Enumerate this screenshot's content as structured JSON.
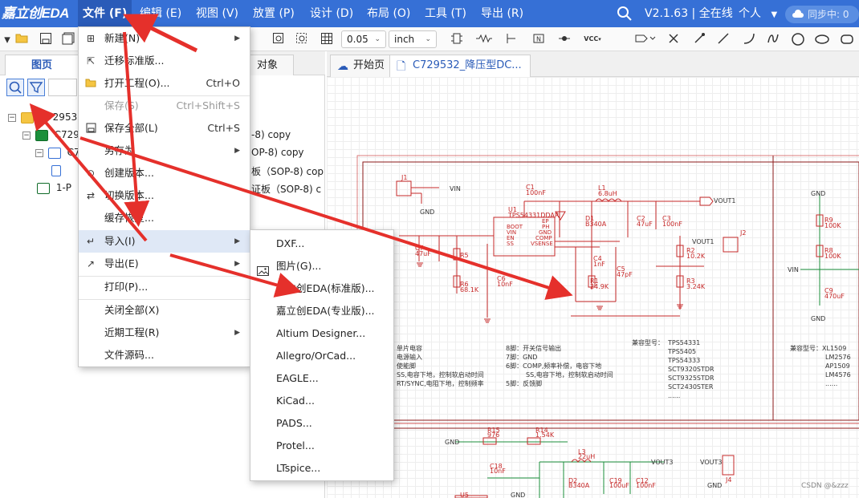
{
  "app": {
    "logo": "嘉立创EDA",
    "version_status": "V2.1.63 | 全在线",
    "user": "个人",
    "sync": "同步中: 0"
  },
  "menubar": [
    {
      "label": "文件 (F)",
      "active": true
    },
    {
      "label": "编辑 (E)"
    },
    {
      "label": "视图 (V)"
    },
    {
      "label": "放置 (P)"
    },
    {
      "label": "设计 (D)"
    },
    {
      "label": "布局 (O)"
    },
    {
      "label": "工具 (T)"
    },
    {
      "label": "导出 (R)"
    }
  ],
  "toolbar": {
    "grid_value": "0.05",
    "unit_value": "inch",
    "vcc_label": "VCC"
  },
  "left_panel": {
    "tabs": [
      "图页",
      "对象"
    ],
    "tree": [
      "C729532",
      "C7295",
      "C72",
      "1-P"
    ],
    "list_fragments": [
      "-8)   copy",
      "OP-8)   copy",
      "板（SOP-8)   cop",
      "证板（SOP-8)   c"
    ]
  },
  "editor_tabs": [
    {
      "label": "开始页"
    },
    {
      "label": "C729532_降压型DC..."
    }
  ],
  "file_menu": {
    "items": [
      {
        "label": "新建(N)",
        "icon": "new-file-icon",
        "submenu": true
      },
      {
        "label": "迁移标准版...",
        "icon": "migrate-icon"
      },
      {
        "label": "打开工程(O)...",
        "icon": "open-folder-icon",
        "shortcut": "Ctrl+O"
      },
      {
        "label": "保存(S)",
        "shortcut": "Ctrl+Shift+S",
        "disabled": true
      },
      {
        "label": "保存全部(L)",
        "icon": "save-icon",
        "shortcut": "Ctrl+S"
      },
      {
        "label": "另存为",
        "submenu": true
      },
      {
        "label": "创建版本...",
        "icon": "version-icon"
      },
      {
        "label": "切换版本...",
        "icon": "switch-version-icon"
      },
      {
        "label": "缓存恢复..."
      },
      {
        "label": "导入(I)",
        "icon": "import-icon",
        "submenu": true,
        "hover": true
      },
      {
        "label": "导出(E)",
        "icon": "export-icon",
        "submenu": true
      },
      {
        "label": "打印(P)..."
      },
      {
        "label": "关闭全部(X)"
      },
      {
        "label": "近期工程(R)",
        "submenu": true
      },
      {
        "label": "文件源码..."
      }
    ]
  },
  "import_submenu": {
    "items": [
      "DXF...",
      "图片(G)...",
      "嘉立创EDA(标准版)...",
      "嘉立创EDA(专业版)...",
      "Altium Designer...",
      "Allegro/OrCad...",
      "EAGLE...",
      "KiCad...",
      "PADS...",
      "Protel...",
      "LTspice..."
    ]
  },
  "schematic": {
    "refs": [
      "J1",
      "C1",
      "L1",
      "U1",
      "D1",
      "C2",
      "C3",
      "C4",
      "C5",
      "C6",
      "C7",
      "R1",
      "R2",
      "R3",
      "R5",
      "R6",
      "J2",
      "VIN",
      "GND",
      "VOUT1"
    ],
    "values": [
      "100nF",
      "6.8uH",
      "TPS54331DDAR",
      "B340A",
      "47uF",
      "100nF",
      "1nF",
      "47pF",
      "10nF",
      "24.9K",
      "10.2K",
      "3.24K",
      "68.1K"
    ],
    "u1_pins_left": [
      "BOOT",
      "VIN",
      "EN",
      "SS"
    ],
    "u1_pins_right": [
      "EP",
      "PH",
      "GND",
      "COMP",
      "VSENSE"
    ],
    "notes_left": [
      "单片电容",
      "电源输入",
      "使能脚",
      "SS,电容下地，控制软启动时间",
      "RT/SYNC,电阻下地，控制频率"
    ],
    "notes_pins": [
      "8脚：开关信号输出",
      "7脚：GND",
      "6脚：COMP,频率补偿，电容下地",
      "SS,电容下地，控制软启动时间",
      "5脚：反馈脚"
    ],
    "compat_title": "兼容型号：",
    "compat": [
      "TPS54331",
      "TPS5405",
      "TPS54333",
      "SCT9320STDR",
      "SCT9325STDR",
      "SCT2430STER",
      "......"
    ],
    "right_refs": [
      "R9",
      "100K",
      "R8",
      "100K",
      "C9",
      "470uF",
      "VIN",
      "GND"
    ],
    "compat2_title": "兼容型号：",
    "compat2": [
      "XL1509",
      "LM2576",
      "AP1509",
      "LM4576",
      "......"
    ],
    "bottom": [
      "R15",
      "976",
      "R14",
      "1.54K",
      "L3",
      "22uH",
      "C18",
      "10nF",
      "D2",
      "B340A",
      "C19",
      "100uF",
      "C12",
      "100nF",
      "VOUT3",
      "J4",
      "U5",
      "GND"
    ]
  },
  "watermark": "CSDN @&zzz",
  "colors": {
    "menubar": "#3670d6",
    "wire": "#c62828",
    "net_green": "#1b8f3b",
    "annotation_arrow": "#e5302b"
  }
}
